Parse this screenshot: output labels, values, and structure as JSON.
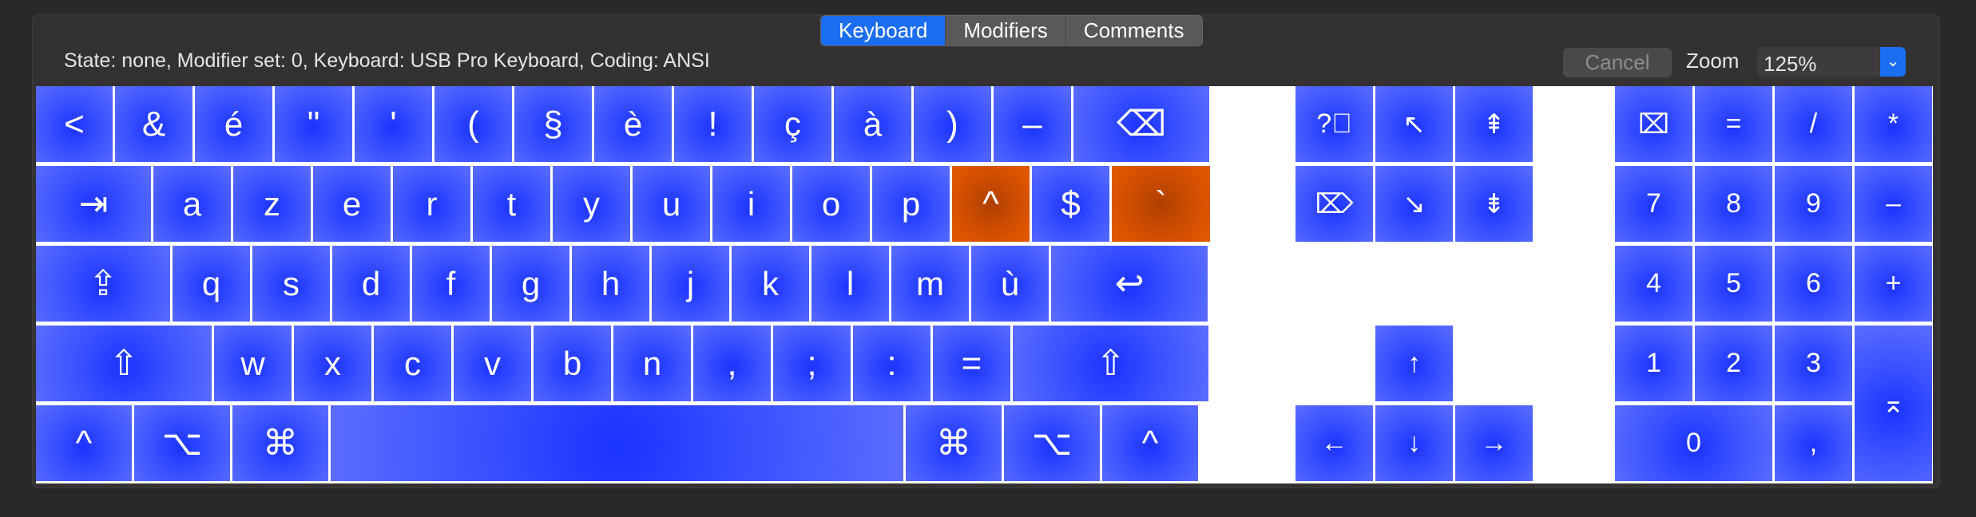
{
  "tabs": [
    "Keyboard",
    "Modifiers",
    "Comments"
  ],
  "status": "State: none, Modifier set: 0, Keyboard: USB Pro Keyboard, Coding: ANSI",
  "cancel_label": "Cancel",
  "zoom_label": "Zoom",
  "zoom_value": "125%",
  "keyboard": {
    "row1": [
      "<",
      "&",
      "é",
      "\"",
      "'",
      "(",
      "§",
      "è",
      "!",
      "ç",
      "à",
      ")",
      "–",
      "⌫"
    ],
    "row2": [
      "⇥",
      "a",
      "z",
      "e",
      "r",
      "t",
      "y",
      "u",
      "i",
      "o",
      "p",
      "^",
      "$",
      "`"
    ],
    "row3": [
      "⇪",
      "q",
      "s",
      "d",
      "f",
      "g",
      "h",
      "j",
      "k",
      "l",
      "m",
      "ù",
      "↩"
    ],
    "row4": [
      "⇧",
      "w",
      "x",
      "c",
      "v",
      "b",
      "n",
      ",",
      ";",
      ":",
      "=",
      "⇧"
    ],
    "row5": [
      "^",
      "⌥",
      "⌘",
      "",
      "⌘",
      "⌥",
      "^"
    ],
    "nav": [
      "?⃝",
      "↖",
      "⇞",
      "⌦",
      "↘",
      "⇟",
      "↑",
      "←",
      "↓",
      "→"
    ],
    "numpad": [
      "⌧",
      "=",
      "/",
      "*",
      "7",
      "8",
      "9",
      "–",
      "4",
      "5",
      "6",
      "+",
      "1",
      "2",
      "3",
      "⌅",
      "0",
      ","
    ]
  }
}
